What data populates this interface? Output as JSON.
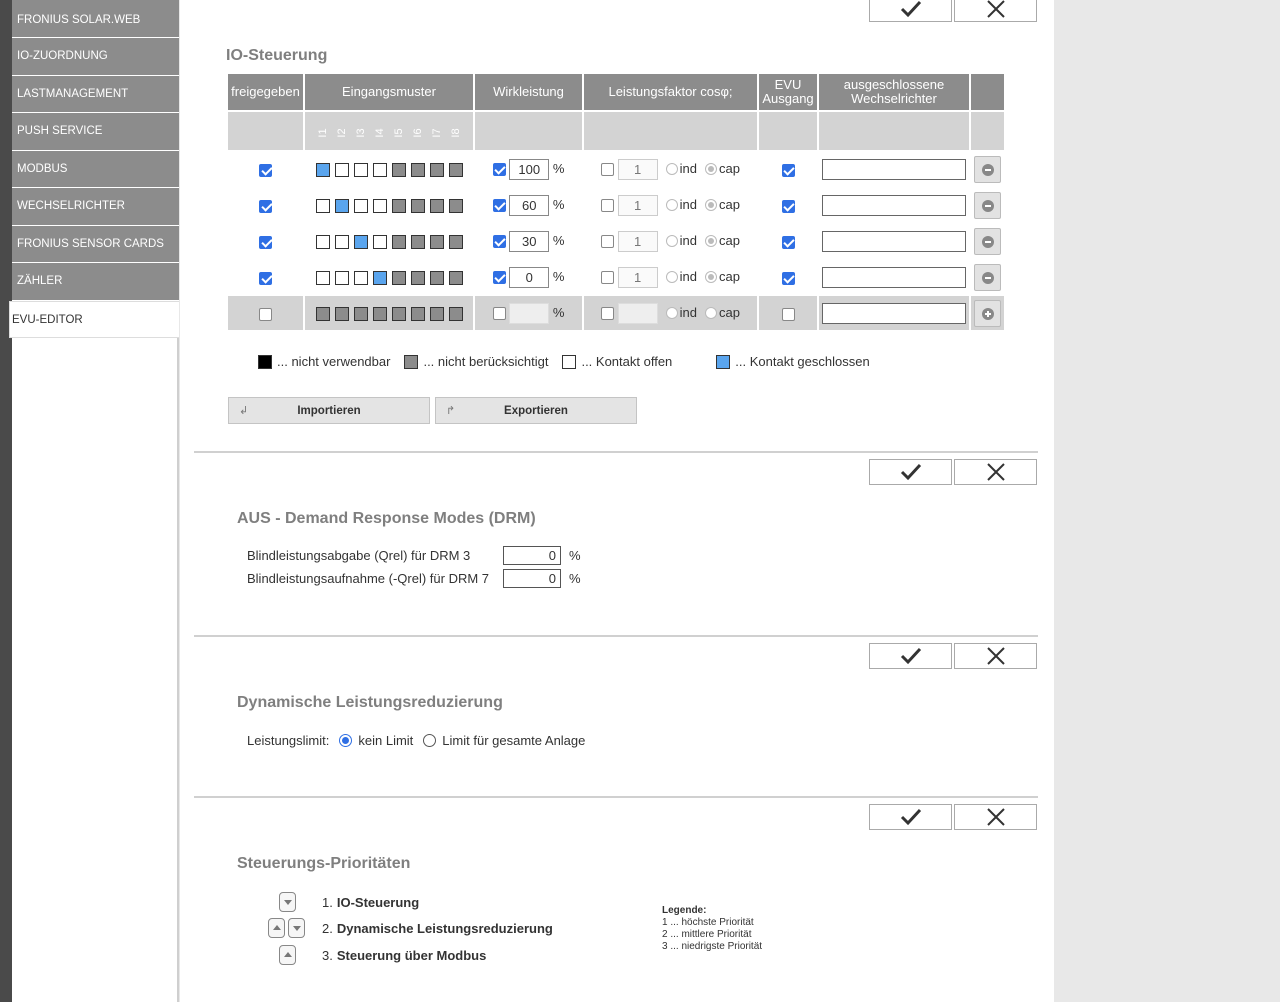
{
  "menu": {
    "items": [
      {
        "label": "FRONIUS SOLAR.WEB"
      },
      {
        "label": "IO-ZUORDNUNG"
      },
      {
        "label": "LASTMANAGEMENT"
      },
      {
        "label": "PUSH SERVICE"
      },
      {
        "label": "MODBUS"
      },
      {
        "label": "WECHSELRICHTER"
      },
      {
        "label": "FRONIUS SENSOR CARDS"
      },
      {
        "label": "ZÄHLER"
      },
      {
        "label": "EVU-EDITOR"
      }
    ],
    "active": "EVU-EDITOR"
  },
  "io": {
    "title": "IO-Steuerung",
    "headers": {
      "enabled": "freigegeben",
      "pattern": "Eingangsmuster",
      "power": "Wirkleistung",
      "cosphi": "Leistungsfaktor cosφ;",
      "evu_line1": "EVU",
      "evu_line2": "Ausgang",
      "excl_line1": "ausgeschlossene",
      "excl_line2": "Wechselrichter"
    },
    "pattern_numbers": [
      "I1",
      "I2",
      "I3",
      "I4",
      "I5",
      "I6",
      "I7",
      "I8"
    ],
    "rows": [
      {
        "enabled": true,
        "pattern": [
          "c",
          "o",
          "o",
          "o",
          "g",
          "g",
          "g",
          "g"
        ],
        "power_enabled": true,
        "power": "100",
        "pct": "%",
        "cos_enabled": false,
        "cos": "1",
        "ind": "ind",
        "cap": "cap",
        "evu": true
      },
      {
        "enabled": true,
        "pattern": [
          "o",
          "c",
          "o",
          "o",
          "g",
          "g",
          "g",
          "g"
        ],
        "power_enabled": true,
        "power": "60",
        "pct": "%",
        "cos_enabled": false,
        "cos": "1",
        "ind": "ind",
        "cap": "cap",
        "evu": true
      },
      {
        "enabled": true,
        "pattern": [
          "o",
          "o",
          "c",
          "o",
          "g",
          "g",
          "g",
          "g"
        ],
        "power_enabled": true,
        "power": "30",
        "pct": "%",
        "cos_enabled": false,
        "cos": "1",
        "ind": "ind",
        "cap": "cap",
        "evu": true
      },
      {
        "enabled": true,
        "pattern": [
          "o",
          "o",
          "o",
          "c",
          "g",
          "g",
          "g",
          "g"
        ],
        "power_enabled": true,
        "power": "0",
        "pct": "%",
        "cos_enabled": false,
        "cos": "1",
        "ind": "ind",
        "cap": "cap",
        "evu": true
      },
      {
        "enabled": false,
        "pattern": [
          "g",
          "g",
          "g",
          "g",
          "g",
          "g",
          "g",
          "g"
        ],
        "power_enabled": false,
        "power": "",
        "pct": "%",
        "cos_enabled": false,
        "cos": "",
        "ind": "ind",
        "cap": "cap",
        "evu": false
      }
    ],
    "legend": {
      "unusable": "... nicht verwendbar",
      "ignored": "... nicht berücksichtigt",
      "open": "... Kontakt offen",
      "closed": "... Kontakt geschlossen"
    },
    "import_label": "Importieren",
    "export_label": "Exportieren"
  },
  "drm": {
    "title": "AUS - Demand Response Modes (DRM)",
    "fields": [
      {
        "label": "Blindleistungsabgabe (Qrel) für DRM 3",
        "value": "0",
        "unit": "%"
      },
      {
        "label": "Blindleistungsaufnahme (-Qrel) für DRM 7",
        "value": "0",
        "unit": "%"
      }
    ]
  },
  "dyn": {
    "title": "Dynamische Leistungsreduzierung",
    "label": "Leistungslimit:",
    "opt_none": "kein Limit",
    "opt_all": "Limit für gesamte Anlage",
    "selected": "kein Limit"
  },
  "prio": {
    "title": "Steuerungs-Prioritäten",
    "items": [
      {
        "num": "1.",
        "label": "IO-Steuerung"
      },
      {
        "num": "2.",
        "label": "Dynamische Leistungsreduzierung"
      },
      {
        "num": "3.",
        "label": "Steuerung über Modbus"
      }
    ],
    "legend_title": "Legende:",
    "legend_lines": [
      "1 ... höchste Priorität",
      "2 ... mittlere Priorität",
      "3 ... niedrigste Priorität"
    ]
  },
  "colors": {
    "accent": "#2f6fe4",
    "contact_closed": "#5aa5ee",
    "header_gray": "#8c8c8c"
  }
}
